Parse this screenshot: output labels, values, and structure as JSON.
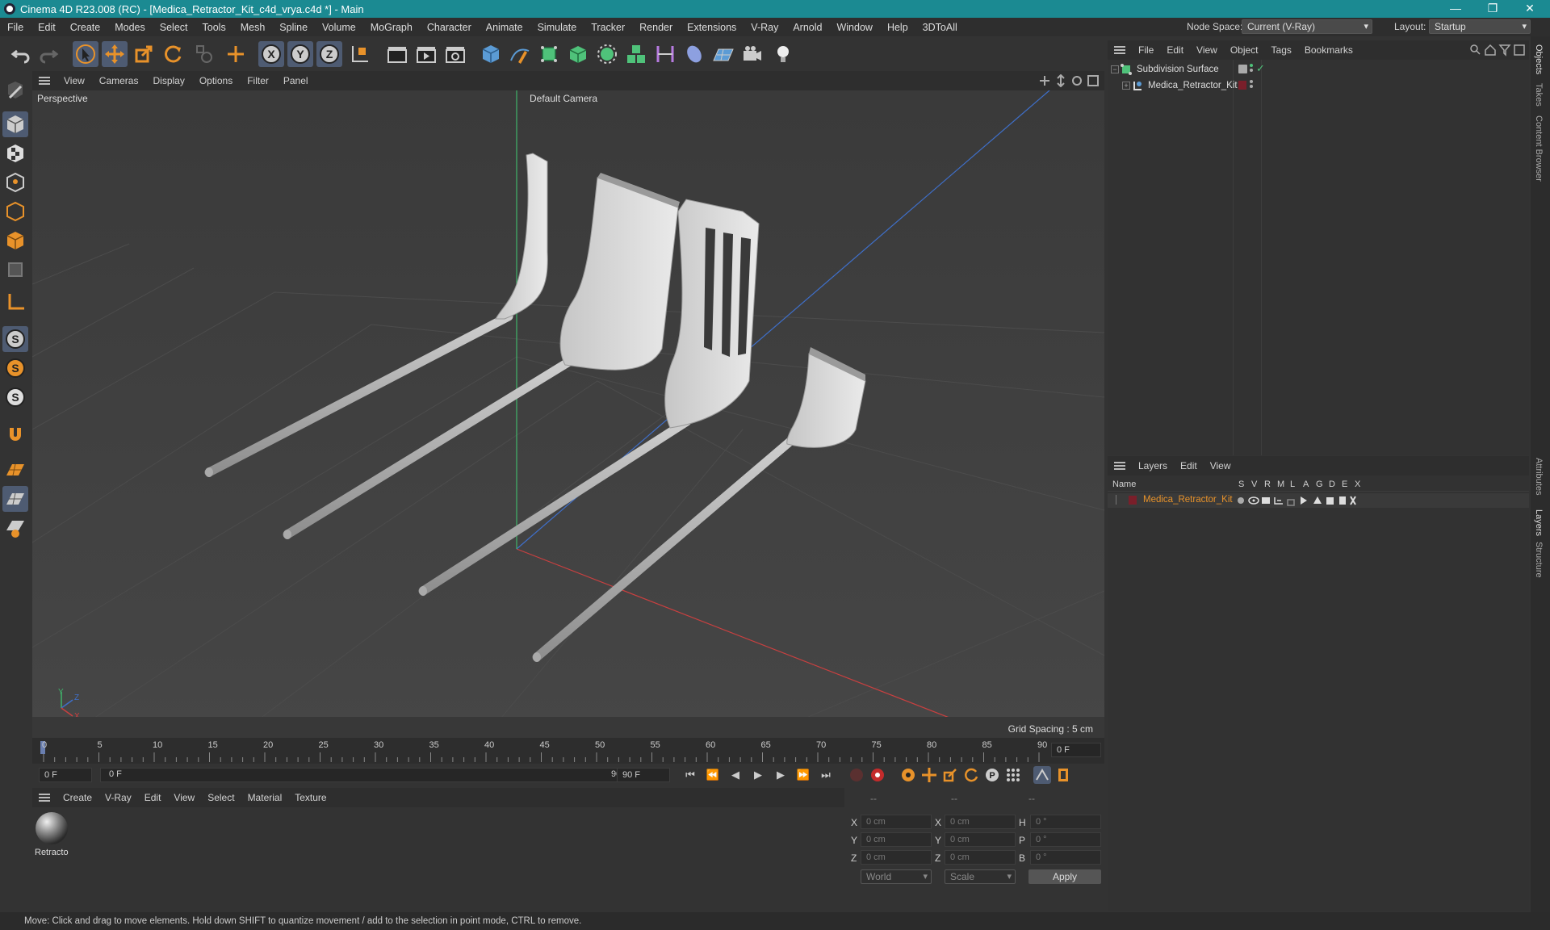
{
  "window": {
    "title": "Cinema 4D R23.008 (RC) - [Medica_Retractor_Kit_c4d_vrya.c4d *] - Main",
    "controls": [
      "—",
      "❐",
      "✕"
    ]
  },
  "menubar": {
    "items": [
      "File",
      "Edit",
      "Create",
      "Modes",
      "Select",
      "Tools",
      "Mesh",
      "Spline",
      "Volume",
      "MoGraph",
      "Character",
      "Animate",
      "Simulate",
      "Tracker",
      "Render",
      "Extensions",
      "V-Ray",
      "Arnold",
      "Window",
      "Help",
      "3DToAll"
    ],
    "node_space_label": "Node Space:",
    "node_space_value": "Current (V-Ray)",
    "layout_label": "Layout:",
    "layout_value": "Startup"
  },
  "viewport": {
    "menu": [
      "View",
      "Cameras",
      "Display",
      "Options",
      "Filter",
      "Panel"
    ],
    "view_name": "Perspective",
    "camera": "Default Camera",
    "grid_spacing": "Grid Spacing : 5 cm",
    "axis_labels": {
      "y": "Y",
      "z": "Z",
      "x": "X"
    }
  },
  "timeline": {
    "ticks": [
      "0",
      "5",
      "10",
      "15",
      "20",
      "25",
      "30",
      "35",
      "40",
      "45",
      "50",
      "55",
      "60",
      "65",
      "70",
      "75",
      "80",
      "85",
      "90"
    ],
    "current_frame": "0 F",
    "start_field": "0 F",
    "range_start": "0 F",
    "range_end": "90 F",
    "end_field": "90 F"
  },
  "materials": {
    "menu": [
      "Create",
      "V-Ray",
      "Edit",
      "View",
      "Select",
      "Material",
      "Texture"
    ],
    "items": [
      {
        "name": "Retracto"
      }
    ]
  },
  "coordinates": {
    "headers": [
      "--",
      "--",
      "--"
    ],
    "rows": [
      {
        "l1": "X",
        "v1": "0 cm",
        "l2": "X",
        "v2": "0 cm",
        "l3": "H",
        "v3": "0 °"
      },
      {
        "l1": "Y",
        "v1": "0 cm",
        "l2": "Y",
        "v2": "0 cm",
        "l3": "P",
        "v3": "0 °"
      },
      {
        "l1": "Z",
        "v1": "0 cm",
        "l2": "Z",
        "v2": "0 cm",
        "l3": "B",
        "v3": "0 °"
      }
    ],
    "mode": "World",
    "transform": "Scale",
    "apply": "Apply"
  },
  "objects_panel": {
    "menu": [
      "File",
      "Edit",
      "View",
      "Object",
      "Tags",
      "Bookmarks"
    ],
    "items": [
      {
        "name": "Subdivision Surface"
      },
      {
        "name": "Medica_Retractor_Kit"
      }
    ]
  },
  "layers_panel": {
    "menu": [
      "Layers",
      "Edit",
      "View"
    ],
    "name_header": "Name",
    "flag_headers": [
      "S",
      "V",
      "R",
      "M",
      "L",
      "A",
      "G",
      "D",
      "E",
      "X"
    ],
    "items": [
      {
        "name": "Medica_Retractor_Kit",
        "color": "#7a1f2a"
      }
    ]
  },
  "right_tabs": [
    "Objects",
    "Takes",
    "Content Browser",
    "Attributes",
    "Layers",
    "Structure"
  ],
  "status": "Move: Click and drag to move elements. Hold down SHIFT to quantize movement / add to the selection in point mode, CTRL to remove.",
  "colors": {
    "title_bar": "#1b8a92",
    "accent_orange": "#e8922a",
    "selection_blue": "#4e5b72",
    "layer_text": "#e8922a"
  }
}
